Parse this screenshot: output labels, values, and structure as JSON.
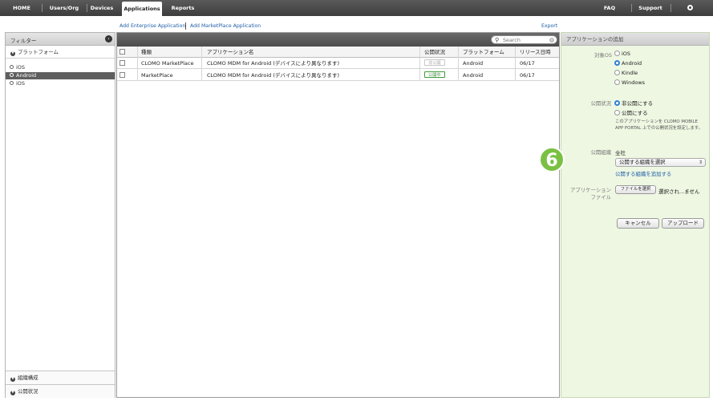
{
  "topnav": {
    "items": [
      "HOME",
      "Users/Org",
      "Devices",
      "Applications",
      "Reports"
    ],
    "active": "Applications",
    "right_items": [
      "FAQ",
      "Support",
      "Settings"
    ]
  },
  "sublinks": {
    "add_enterprise": "Add Enterprise Application",
    "add_marketplace": "Add MarketPlace Application",
    "export": "Export"
  },
  "filter": {
    "title": "フィルター",
    "platform_section": "プラットフォーム",
    "platforms": [
      "iOS",
      "Android",
      "iOS"
    ],
    "selected_index": 1,
    "org_section": "組織構成",
    "status_section": "公開状況"
  },
  "search": {
    "placeholder": "Search"
  },
  "table": {
    "headers": [
      "種類",
      "アプリケーション名",
      "公開状況",
      "プラットフォーム",
      "リリース日時"
    ],
    "rows": [
      {
        "type": "CLOMO MarketPlace",
        "name": "CLOMO MDM for Android (デバイスにより異なります)",
        "status": "非公開",
        "status_kind": "off",
        "platform": "Android",
        "date": "06/17"
      },
      {
        "type": "MarketPlace",
        "name": "CLOMO MDM for Android (デバイスにより異なります)",
        "status": "公開中",
        "status_kind": "on",
        "platform": "Android",
        "date": "06/17"
      }
    ]
  },
  "addpanel": {
    "title": "アプリケーションの追加",
    "target_os_label": "対象OS",
    "os_options": [
      "iOS",
      "Android",
      "Kindle",
      "Windows"
    ],
    "os_selected": "Android",
    "publish_label": "公開状況",
    "publish_options": [
      "非公開にする",
      "公開にする"
    ],
    "publish_selected": "非公開にする",
    "publish_note": "このアプリケーションを CLOMO MOBILE APP PORTAL 上での公開状況を設定します。",
    "org_label": "公開組織",
    "org_value": "全社",
    "org_select": "公開する組織を選択",
    "org_add_link": "公開する組織を追加する",
    "file_label_1": "アプリケーション",
    "file_label_2": "ファイル",
    "file_button": "ファイルを選択",
    "file_status": "選択され...ません",
    "cancel": "キャンセル",
    "upload": "アップロード"
  },
  "step_number": "6",
  "colors": {
    "nav_bg": "#4a4a4a",
    "panel_green": "#eef7e2",
    "step_green": "#7ac143",
    "link_blue": "#1f5fa8"
  }
}
